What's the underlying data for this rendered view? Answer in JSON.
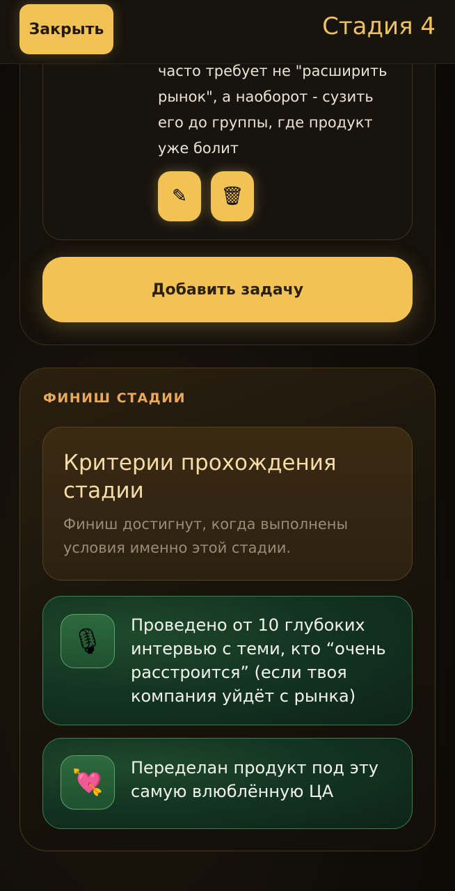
{
  "header": {
    "close_label": "Закрыть",
    "stage_title": "Стадия 4"
  },
  "tasks": {
    "task_text": "часто требует не \"расширить рынок\", а наоборот - сузить его до группы, где продукт уже болит",
    "edit_icon": "pencil-icon",
    "delete_icon": "trash-can-icon",
    "edit_glyph": "✎",
    "delete_glyph": "🗑",
    "add_task_label": "Добавить задачу"
  },
  "finish": {
    "section_label": "ФИНИШ СТАДИИ",
    "criteria_title": "Критерии прохождения стадии",
    "criteria_subtitle": "Финиш достигнут, когда выполнены условия именно этой стадии.",
    "goals": [
      {
        "icon": "microphone-icon",
        "glyph": "🎙",
        "text": "Проведено от 10 глубоких интервью с теми, кто “очень расстроится” (если твоя компания уйдёт с рынка)"
      },
      {
        "icon": "heart-with-arrow-icon",
        "glyph": "💘",
        "text": "Переделан продукт под эту самую влюблённую ЦА"
      }
    ]
  },
  "colors": {
    "accent": "#f3c255",
    "stage_title": "#f0c15f",
    "section_label": "#e9a85a",
    "goal_card": "#143422",
    "goal_border": "#3f7e4e"
  }
}
